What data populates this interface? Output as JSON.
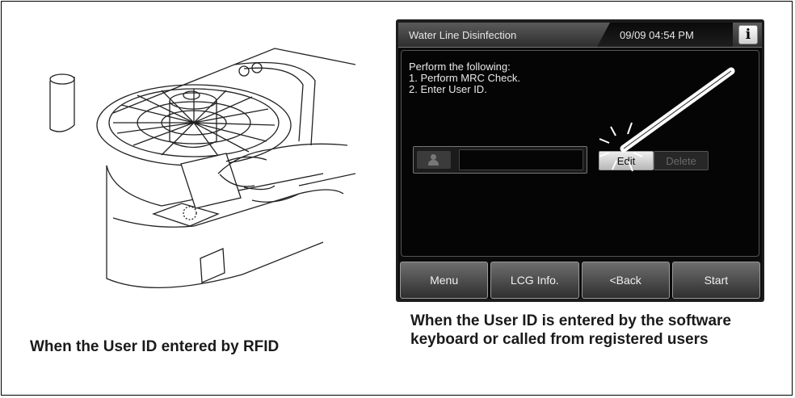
{
  "captions": {
    "left": "When the User ID entered by RFID",
    "right": "When the User ID is entered by the software keyboard or called from registered users"
  },
  "screen": {
    "title": "Water Line Disinfection",
    "datetime": "09/09 04:54 PM",
    "info_icon": "i",
    "message": "Perform the following:\n1. Perform MRC Check.\n2. Enter User ID.",
    "user_id_value": "",
    "edit_label": "Edit",
    "delete_label": "Delete",
    "nav": {
      "menu": "Menu",
      "lcg_info": "LCG Info.",
      "back": "<Back",
      "start": "Start"
    }
  }
}
